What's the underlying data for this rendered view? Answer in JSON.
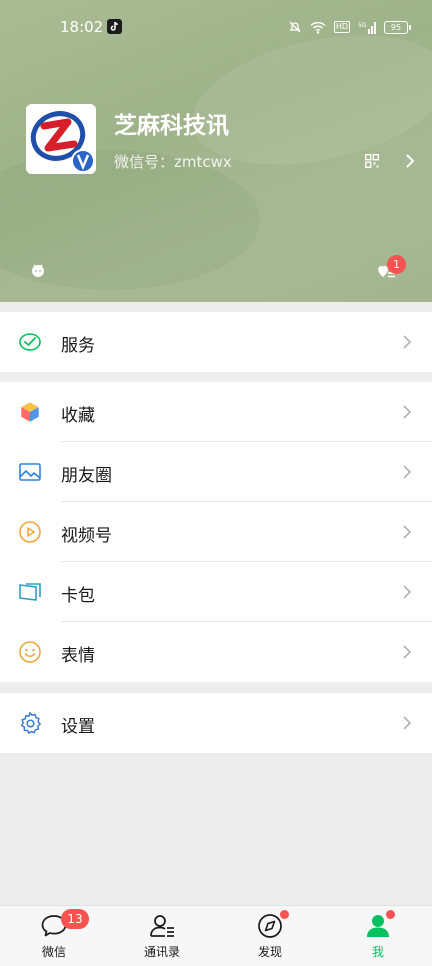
{
  "status_bar": {
    "time": "18:02",
    "battery": "95",
    "icons": [
      "tiktok-icon",
      "mute-bell-icon",
      "wifi-icon",
      "hd-icon",
      "signal-5g-icon",
      "battery-icon"
    ],
    "hd_label": "HD"
  },
  "profile": {
    "name": "芝麻科技讯",
    "wechat_id": "微信号：zmtcwx",
    "notification_count": "1"
  },
  "menu": {
    "group1": [
      {
        "label": "服务",
        "icon": "service-icon"
      }
    ],
    "group2": [
      {
        "label": "收藏",
        "icon": "favorites-icon"
      },
      {
        "label": "朋友圈",
        "icon": "moments-icon"
      },
      {
        "label": "视频号",
        "icon": "channels-icon"
      },
      {
        "label": "卡包",
        "icon": "card-wallet-icon"
      },
      {
        "label": "表情",
        "icon": "sticker-icon"
      }
    ],
    "group3": [
      {
        "label": "设置",
        "icon": "settings-icon"
      }
    ]
  },
  "tabbar": {
    "tabs": [
      {
        "label": "微信",
        "badge": "13"
      },
      {
        "label": "通讯录"
      },
      {
        "label": "发现"
      },
      {
        "label": "我"
      }
    ],
    "active_color": "#07c160"
  },
  "colors": {
    "header_bg": "#a6b891",
    "badge_red": "#fa5151",
    "wechat_green": "#07c160"
  }
}
